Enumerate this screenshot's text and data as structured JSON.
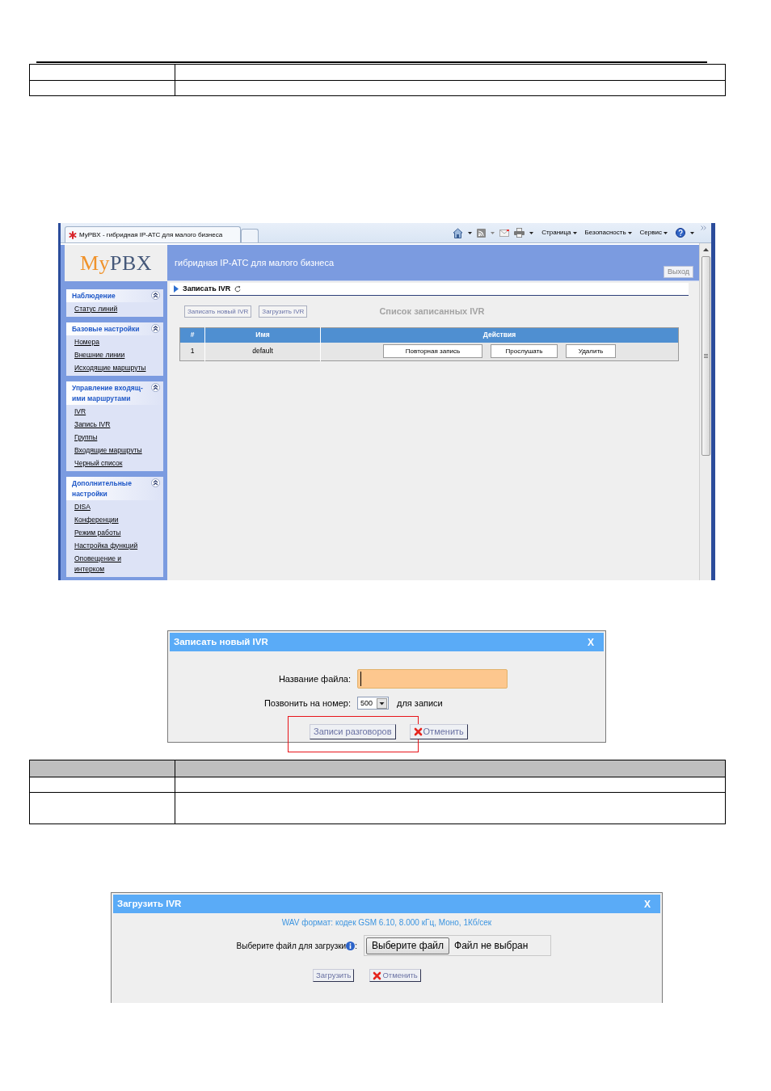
{
  "browser": {
    "tab_title": "MyPBX - гибридная IP-АТС для малого бизнеса",
    "menus": [
      "Страница",
      "Безопасность",
      "Сервис"
    ]
  },
  "app": {
    "logo": {
      "accent": "My",
      "rest": "PBX"
    },
    "tagline": "гибридная IP-АТС для малого бизнеса",
    "logout_button": "Выход",
    "sidebar": [
      {
        "title": "Наблюдение",
        "expanded": true,
        "items": [
          "Статус линий"
        ]
      },
      {
        "title": "Базовые настройки",
        "expanded": true,
        "items": [
          "Номера",
          "Внешние линии",
          "Исходящие маршруты"
        ]
      },
      {
        "title": "Управление входящ-ими маршрутами",
        "expanded": true,
        "items": [
          "IVR",
          "Запись IVR",
          "Группы",
          "Входящие маршруты",
          "Черный список"
        ]
      },
      {
        "title": "Дополнительные настройки",
        "expanded": true,
        "items": [
          "DISA",
          "Конференции",
          "Режим работы",
          "Настройка функций",
          "Оповещение и интерком"
        ]
      }
    ],
    "page_title": "Записать IVR",
    "buttons": [
      "Записать новый IVR",
      "Загрузить IVR"
    ],
    "list_title": "Список записанных IVR",
    "table": {
      "columns": [
        "#",
        "Имя",
        "Действия"
      ],
      "rows": [
        {
          "number": "1",
          "name": "default",
          "actions": [
            "Повторная запись",
            "Прослушать",
            "Удалить"
          ]
        }
      ]
    }
  },
  "record_dialog": {
    "title": "Записать новый IVR",
    "close": "X",
    "file_name_label": "Название файла:",
    "call_label": "Позвонить на номер:",
    "call_number": "500",
    "call_suffix": "для записи",
    "buttons": [
      {
        "kind": "plain",
        "label": "Записи разговоров",
        "highlighted": true
      },
      {
        "kind": "cancel",
        "label": "Отменить",
        "highlighted": false
      }
    ]
  },
  "upload_dialog": {
    "title": "Загрузить IVR",
    "close": "X",
    "hint": "WAV формат: кодек GSM 6.10, 8.000 кГц, Моно, 1Кб/сек",
    "file_label": "Выберите файл для загрузки",
    "label_colon": ":",
    "choose_button": "Выберите файл",
    "file_status": "Файл не выбран",
    "buttons": [
      {
        "kind": "plain",
        "label": "Загрузить",
        "highlighted": false
      },
      {
        "kind": "cancel",
        "label": "Отменить",
        "highlighted": false
      }
    ]
  }
}
